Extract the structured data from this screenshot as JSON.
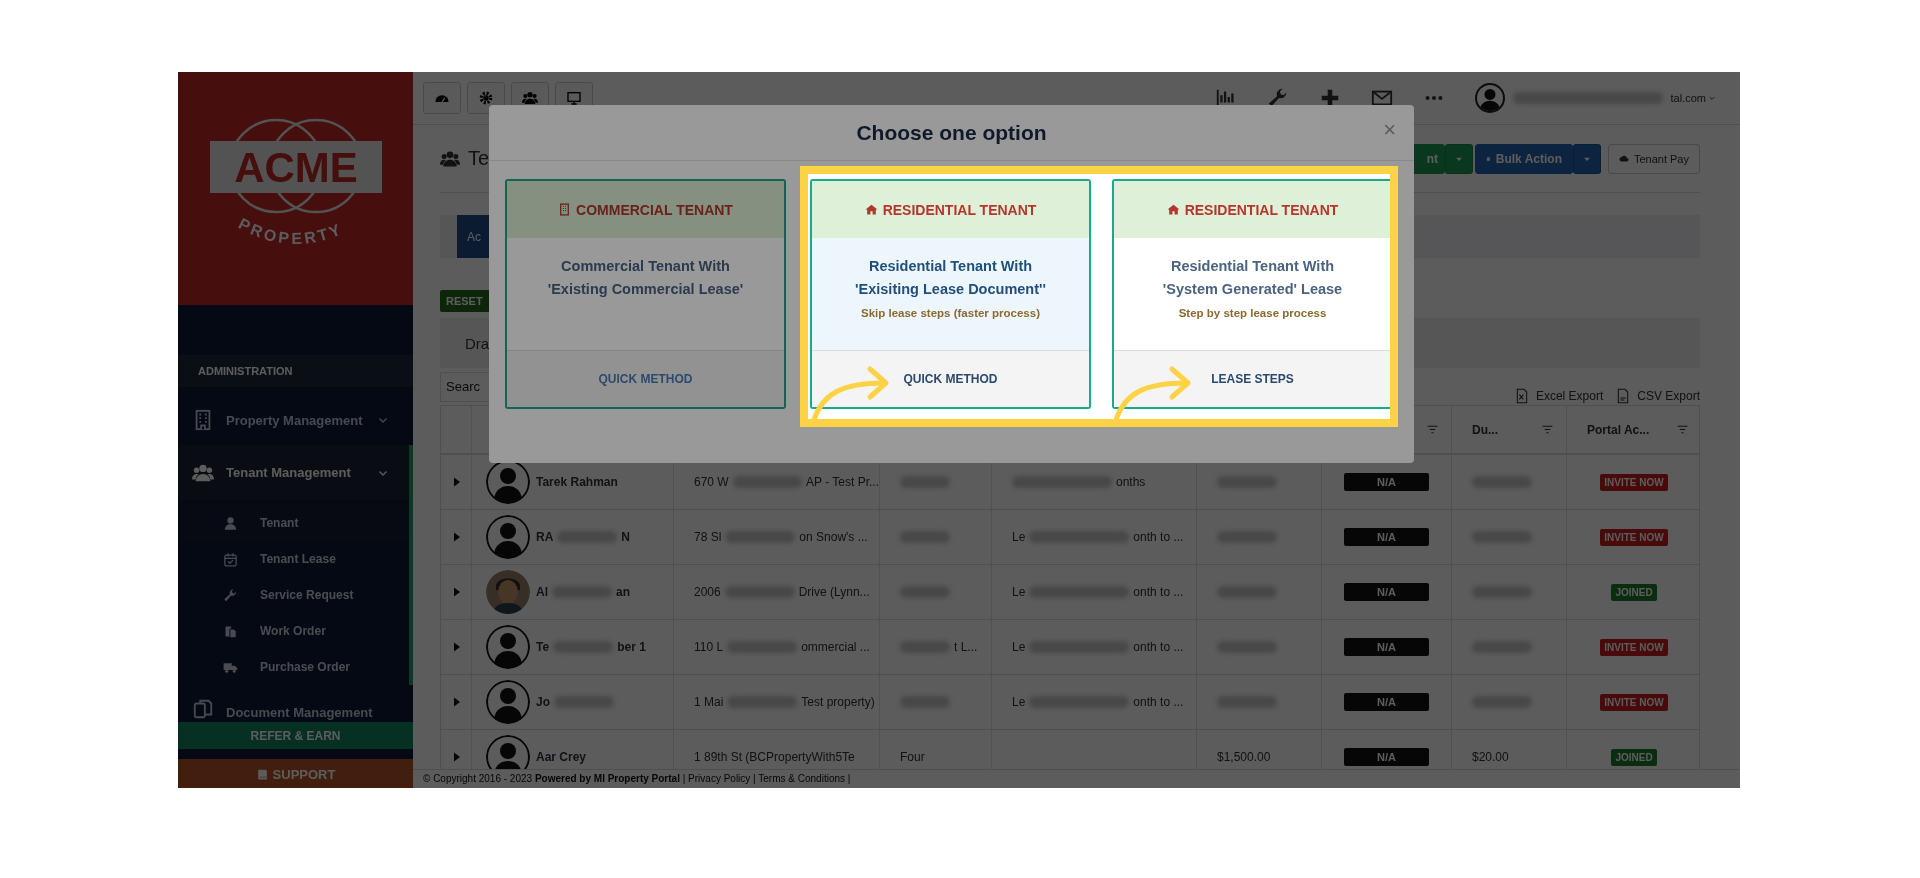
{
  "sidebar": {
    "logo": {
      "wordmark": "ACME",
      "tagline": "PROPERTY"
    },
    "section_title": "ADMINISTRATION",
    "nav": [
      {
        "label": "Property Management",
        "expanded": false,
        "selected": false
      },
      {
        "label": "Tenant Management",
        "expanded": true,
        "selected": true,
        "children": [
          {
            "label": "Tenant",
            "selected": true
          },
          {
            "label": "Tenant Lease",
            "selected": false
          },
          {
            "label": "Service Request",
            "selected": false
          },
          {
            "label": "Work Order",
            "selected": false
          },
          {
            "label": "Purchase Order",
            "selected": false
          }
        ]
      },
      {
        "label": "Document Management",
        "selected": false
      }
    ],
    "refer_button": "REFER & EARN",
    "support_button": "SUPPORT"
  },
  "topbar": {
    "user_suffix": "tal.com"
  },
  "page_header": {
    "title": "Te",
    "actions": [
      {
        "label": "nt",
        "kind": "green"
      },
      {
        "label": "Bulk Action",
        "kind": "blue"
      },
      {
        "label": "Tenant Pay",
        "kind": "plain"
      }
    ]
  },
  "tabs": [
    {
      "label": "Ac",
      "selected": true
    }
  ],
  "reset_button": "RESET",
  "panel": {
    "title": "Dra",
    "search": {
      "placeholder": "Searc"
    },
    "exports": [
      "Excel Export",
      "CSV Export"
    ]
  },
  "table": {
    "columns": [
      {
        "label": "Du..."
      },
      {
        "label": "Portal Ac..."
      }
    ],
    "rows": [
      {
        "expanded": false,
        "avatar": {
          "kind": "silhouette"
        },
        "cells": {
          "name": [
            {
              "kind": "text",
              "text": "Tarek Rahman"
            }
          ],
          "property": [
            {
              "kind": "text",
              "text": "670 W"
            },
            {
              "kind": "blur"
            },
            {
              "kind": "text",
              "text": "AP - Test Pr..."
            }
          ],
          "type": [
            {
              "kind": "blur"
            }
          ],
          "term": [
            {
              "kind": "blur"
            },
            {
              "kind": "text",
              "text": "onths"
            }
          ],
          "rent": [
            {
              "kind": "blur"
            }
          ],
          "due": [
            {
              "kind": "blur"
            }
          ]
        },
        "status": "N/A",
        "portal": {
          "text": "INVITE NOW",
          "kind": "invite"
        }
      },
      {
        "expanded": false,
        "avatar": {
          "kind": "silhouette"
        },
        "cells": {
          "name": [
            {
              "kind": "text",
              "text": "RA"
            },
            {
              "kind": "blur"
            },
            {
              "kind": "text",
              "text": "N"
            }
          ],
          "property": [
            {
              "kind": "text",
              "text": "78 Sl"
            },
            {
              "kind": "blur"
            },
            {
              "kind": "text",
              "text": "on Snow's ..."
            }
          ],
          "type": [
            {
              "kind": "blur"
            }
          ],
          "term": [
            {
              "kind": "text",
              "text": "Le"
            },
            {
              "kind": "blur"
            },
            {
              "kind": "text",
              "text": "onth to ..."
            }
          ],
          "rent": [
            {
              "kind": "blur"
            }
          ],
          "due": [
            {
              "kind": "blur"
            }
          ]
        },
        "status": "N/A",
        "portal": {
          "text": "INVITE NOW",
          "kind": "invite"
        }
      },
      {
        "expanded": false,
        "cells": {
          "name": [
            {
              "kind": "text",
              "text": "Al"
            },
            {
              "kind": "blur"
            },
            {
              "kind": "text",
              "text": "an"
            }
          ],
          "property": [
            {
              "kind": "text",
              "text": "2006"
            },
            {
              "kind": "blur"
            },
            {
              "kind": "text",
              "text": "Drive (Lynn..."
            }
          ],
          "type": [
            {
              "kind": "blur"
            }
          ],
          "term": [
            {
              "kind": "text",
              "text": "Le"
            },
            {
              "kind": "blur"
            },
            {
              "kind": "text",
              "text": "onth to ..."
            }
          ],
          "rent": [
            {
              "kind": "blur"
            }
          ],
          "due": [
            {
              "kind": "blur"
            }
          ]
        },
        "status": "N/A",
        "portal": {
          "text": "JOINED",
          "kind": "joined"
        }
      },
      {
        "expanded": false,
        "avatar": {
          "kind": "silhouette"
        },
        "cells": {
          "name": [
            {
              "kind": "text",
              "text": "Te"
            },
            {
              "kind": "blur"
            },
            {
              "kind": "text",
              "text": "ber 1"
            }
          ],
          "property": [
            {
              "kind": "text",
              "text": "110 L"
            },
            {
              "kind": "blur"
            },
            {
              "kind": "text",
              "text": "ommercial ..."
            }
          ],
          "type": [
            {
              "kind": "blur"
            },
            {
              "kind": "text",
              "text": "t L..."
            }
          ],
          "term": [
            {
              "kind": "text",
              "text": "Le"
            },
            {
              "kind": "blur"
            },
            {
              "kind": "text",
              "text": "onth to ..."
            }
          ],
          "rent": [
            {
              "kind": "blur"
            }
          ],
          "due": [
            {
              "kind": "blur"
            }
          ]
        },
        "status": "N/A",
        "portal": {
          "text": "INVITE NOW",
          "kind": "invite"
        }
      },
      {
        "expanded": false,
        "avatar": {
          "kind": "silhouette"
        },
        "cells": {
          "name": [
            {
              "kind": "text",
              "text": "Jo"
            },
            {
              "kind": "blur"
            }
          ],
          "property": [
            {
              "kind": "text",
              "text": "1 Mai"
            },
            {
              "kind": "blur"
            },
            {
              "kind": "text",
              "text": "Test property)"
            }
          ],
          "type": [
            {
              "kind": "blur"
            }
          ],
          "term": [
            {
              "kind": "text",
              "text": "Le"
            },
            {
              "kind": "blur"
            },
            {
              "kind": "text",
              "text": "onth to ..."
            }
          ],
          "rent": [
            {
              "kind": "blur"
            }
          ],
          "due": [
            {
              "kind": "blur"
            }
          ]
        },
        "status": "N/A",
        "portal": {
          "text": "INVITE NOW",
          "kind": "invite"
        }
      },
      {
        "expanded": false,
        "avatar": {
          "kind": "silhouette"
        },
        "cells": {
          "name": [
            {
              "kind": "text",
              "text": "Aar Crey"
            }
          ],
          "property": [
            {
              "kind": "text",
              "text": "1 89th St (BCPropertyWith5Te"
            }
          ],
          "type": [
            {
              "kind": "text",
              "text": "Four"
            }
          ],
          "rent": [
            {
              "kind": "text",
              "text": "$1,500.00"
            }
          ],
          "due": [
            {
              "kind": "text",
              "text": "$20.00"
            }
          ]
        },
        "status": "N/A",
        "portal": {
          "text": "JOINED",
          "kind": "joined"
        }
      }
    ]
  },
  "footer": {
    "text": "© Copyright 2016 - 2023 **Powered by MI Property Portal** | Privacy Policy | Terms & Conditions |"
  },
  "modal": {
    "title": "Choose one option",
    "close": "×",
    "options": [
      {
        "title": "COMMERCIAL TENANT",
        "lines": [
          "Commercial Tenant With",
          "'Existing Commercial Lease'"
        ],
        "action": "QUICK METHOD",
        "selected": false,
        "highlighted": false
      },
      {
        "title": "RESIDENTIAL TENANT",
        "lines": [
          "Residential Tenant With",
          "'Exisiting Lease Document''"
        ],
        "note": "Skip lease steps (faster process)",
        "action": "QUICK METHOD",
        "selected": true,
        "highlighted": true
      },
      {
        "title": "RESIDENTIAL TENANT",
        "lines": [
          "Residential Tenant With",
          "'System Generated' Lease"
        ],
        "note": "Step by step lease process",
        "action": "LEASE STEPS",
        "selected": false,
        "highlighted": true
      }
    ]
  }
}
